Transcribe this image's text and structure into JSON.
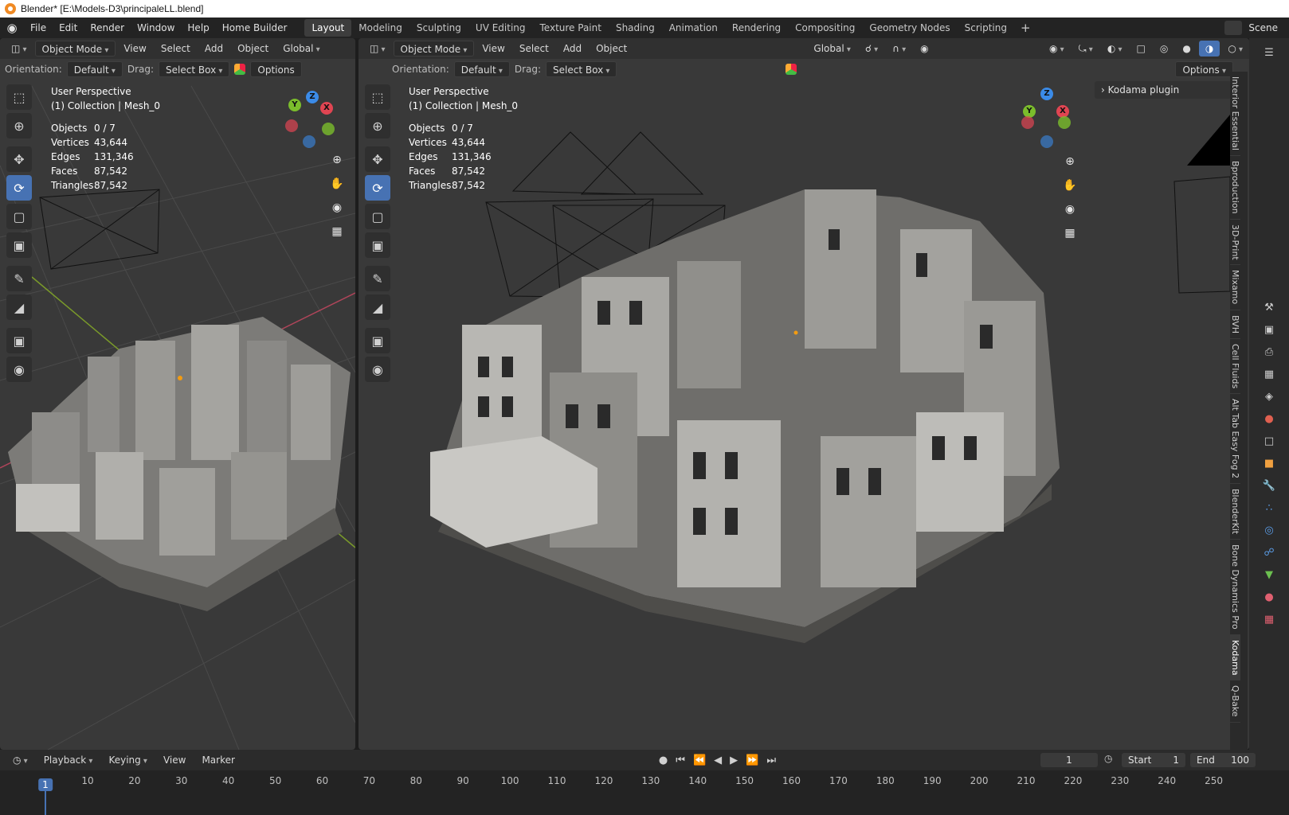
{
  "window": {
    "title": "Blender* [E:\\Models-D3\\principaleLL.blend]"
  },
  "menubar": {
    "items": [
      "File",
      "Edit",
      "Render",
      "Window",
      "Help",
      "Home Builder"
    ],
    "workspaces": [
      "Layout",
      "Modeling",
      "Sculpting",
      "UV Editing",
      "Texture Paint",
      "Shading",
      "Animation",
      "Rendering",
      "Compositing",
      "Geometry Nodes",
      "Scripting"
    ],
    "active_workspace": "Layout",
    "add_workspace": "+",
    "scene": "Scene"
  },
  "viewport_left": {
    "mode": "Object Mode",
    "menus": [
      "View",
      "Select",
      "Add",
      "Object"
    ],
    "transform": "Global",
    "orientation_label": "Orientation:",
    "orientation_value": "Default",
    "drag_label": "Drag:",
    "drag_value": "Select Box",
    "options": "Options",
    "perspective": "User Perspective",
    "collection": "(1) Collection | Mesh_0",
    "stats": [
      {
        "label": "Objects",
        "value": "0 / 7"
      },
      {
        "label": "Vertices",
        "value": "43,644"
      },
      {
        "label": "Edges",
        "value": "131,346"
      },
      {
        "label": "Faces",
        "value": "87,542"
      },
      {
        "label": "Triangles",
        "value": "87,542"
      }
    ]
  },
  "viewport_right": {
    "mode": "Object Mode",
    "menus": [
      "View",
      "Select",
      "Add",
      "Object"
    ],
    "transform": "Global",
    "orientation_label": "Orientation:",
    "orientation_value": "Default",
    "drag_label": "Drag:",
    "drag_value": "Select Box",
    "options": "Options",
    "perspective": "User Perspective",
    "collection": "(1) Collection | Mesh_0",
    "stats": [
      {
        "label": "Objects",
        "value": "0 / 7"
      },
      {
        "label": "Vertices",
        "value": "43,644"
      },
      {
        "label": "Edges",
        "value": "131,346"
      },
      {
        "label": "Faces",
        "value": "87,542"
      },
      {
        "label": "Triangles",
        "value": "87,542"
      }
    ]
  },
  "gizmo": {
    "x": "X",
    "y": "Y",
    "z": "Z"
  },
  "kodama_panel": "Kodama plugin",
  "sidebar_tabs": [
    "Interior Essential",
    "Bproduction",
    "3D-Print",
    "Mixamo",
    "BVH",
    "Cell Fluids",
    "Alt Tab Easy Fog 2",
    "BlenderKit",
    "Bone Dynamics Pro",
    "Kodama",
    "Q-Bake"
  ],
  "sidebar_active": "Kodama",
  "timeline": {
    "menus": [
      "Playback",
      "Keying",
      "View",
      "Marker"
    ],
    "current_frame": "1",
    "start_label": "Start",
    "start": "1",
    "end_label": "End",
    "end": "100",
    "ruler": [
      "10",
      "20",
      "30",
      "40",
      "50",
      "60",
      "70",
      "80",
      "90",
      "100",
      "110",
      "120",
      "130",
      "140",
      "150",
      "160",
      "170",
      "180",
      "190",
      "200",
      "210",
      "220",
      "230",
      "240",
      "250"
    ]
  },
  "colors": {
    "accent": "#4772b3",
    "x_axis": "#e04552",
    "y_axis": "#7bbd2c",
    "z_axis": "#3b8be8"
  }
}
